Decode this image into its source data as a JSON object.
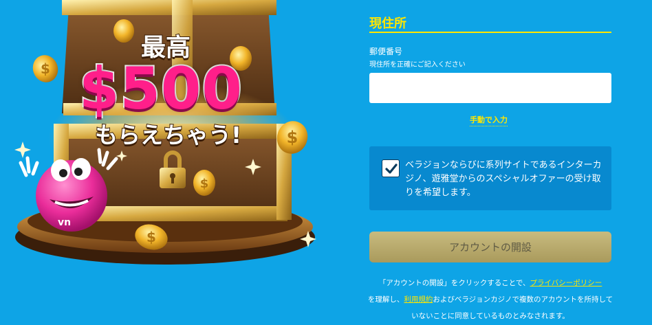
{
  "promo": {
    "pre_text": "最高",
    "amount_text": "$500",
    "post_text": "もらえちゃう!"
  },
  "form": {
    "section_title": "現住所",
    "postal": {
      "label": "郵便番号",
      "hint": "現住所を正確にご記入ください",
      "value": "",
      "placeholder": ""
    },
    "manual_entry_link": "手動で入力",
    "consent": {
      "checked": true,
      "text": "ベラジョンならびに系列サイトであるインターカジノ、遊雅堂からのスペシャルオファーの受け取りを希望します。"
    },
    "submit_label": "アカウントの開設",
    "legal": {
      "part1": "「アカウントの開設」をクリックすることで、",
      "privacy_link": "プライバシーポリシー",
      "part2": "を理解し、",
      "terms_link": "利用規約",
      "part3": "およびベラジョンカジノで複数のアカウントを所持していないことに同意しているものとみなされます。"
    }
  },
  "colors": {
    "background": "#0ea4e6",
    "accent": "#ffe600",
    "panel": "#0889cf",
    "button": "#b8aa6a"
  }
}
